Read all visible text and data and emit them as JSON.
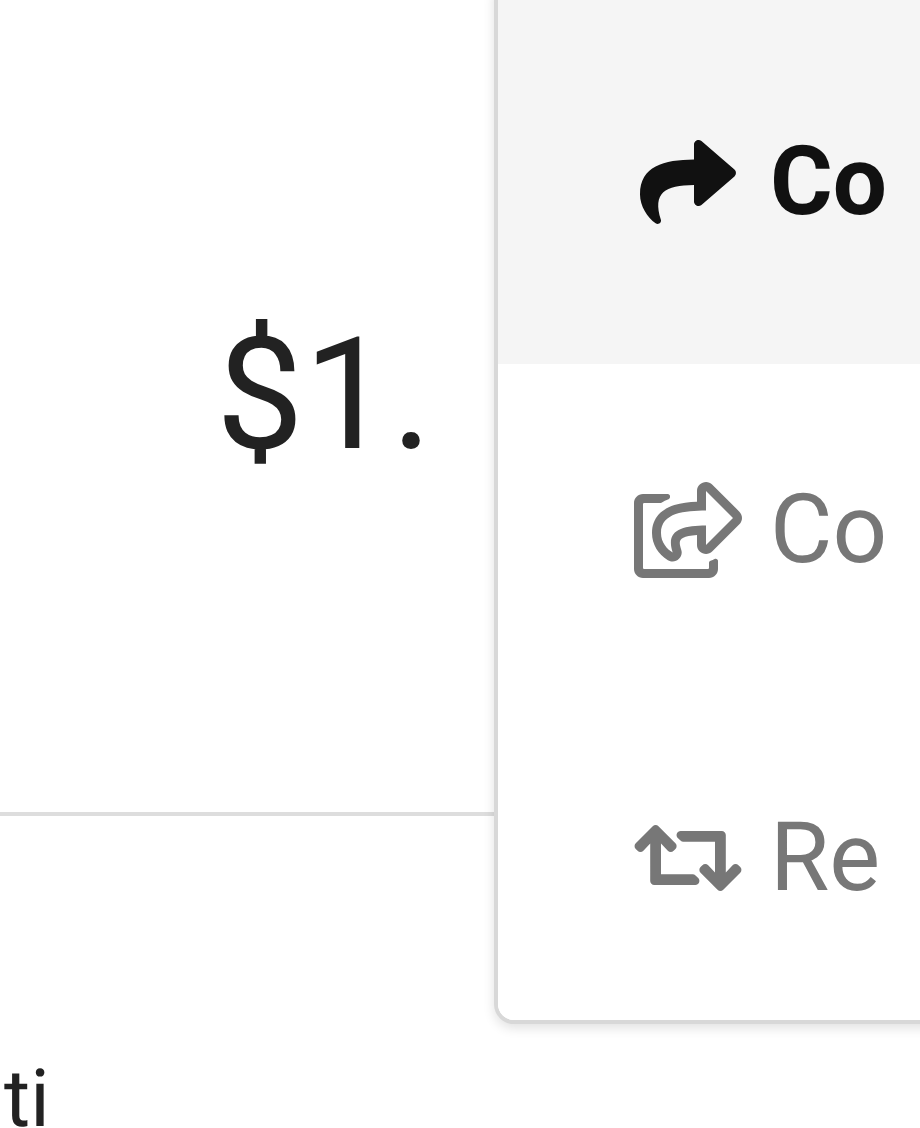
{
  "price": "$1.",
  "menu": {
    "items": [
      {
        "label": "Co",
        "selected": true
      },
      {
        "label": "Co",
        "selected": false
      },
      {
        "label": "Re",
        "selected": false
      }
    ]
  },
  "footer_text": "ti"
}
